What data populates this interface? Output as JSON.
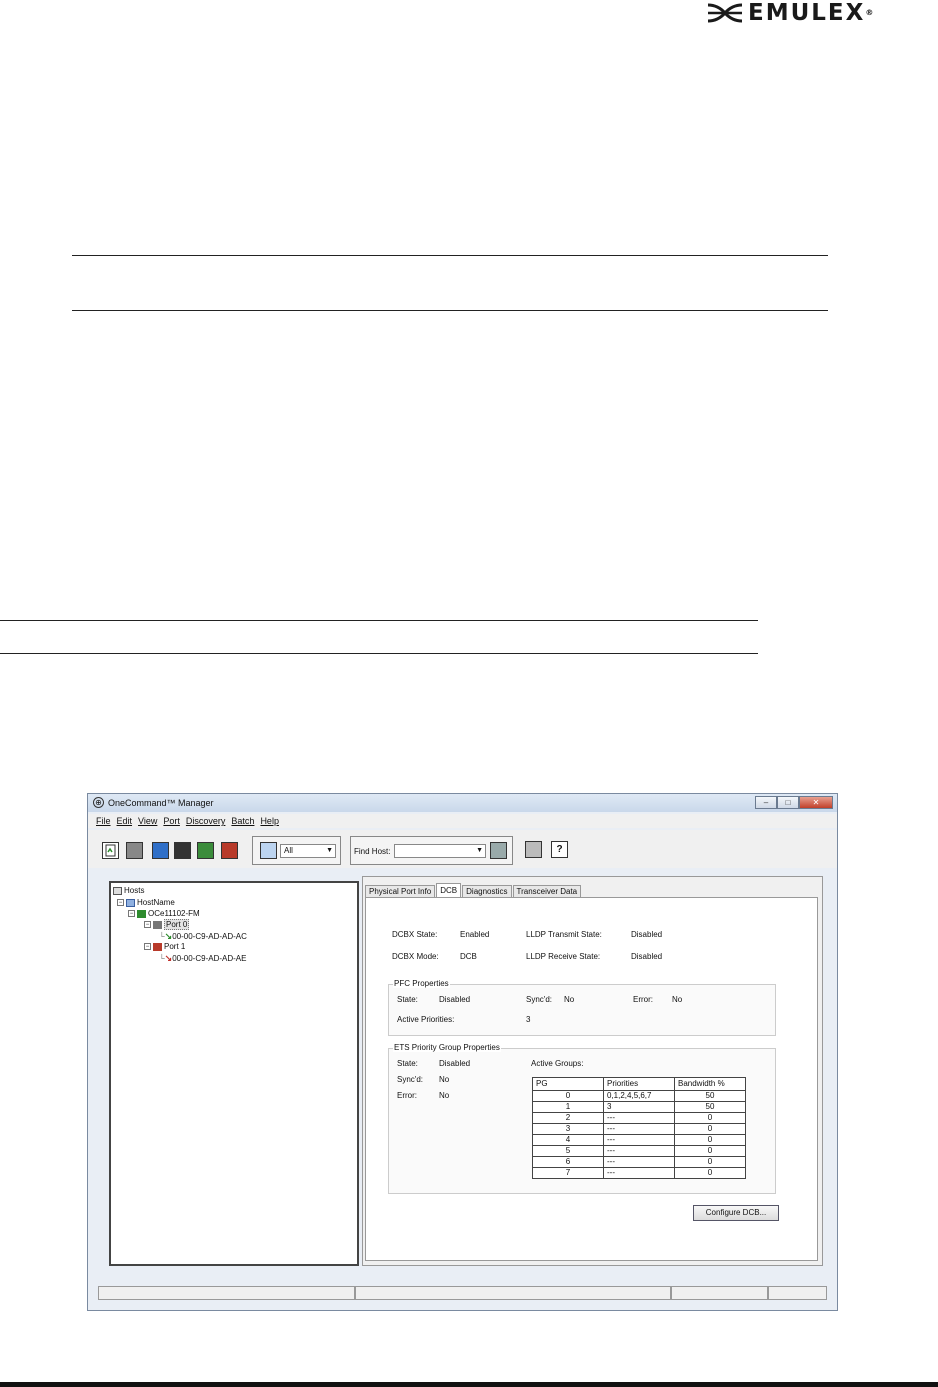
{
  "brand": {
    "name": "EMULEX",
    "registered": "®"
  },
  "app": {
    "title": "OneCommand™ Manager",
    "window_buttons": {
      "minimize": "–",
      "maximize": "□",
      "close": "✕"
    },
    "menu": [
      "File",
      "Edit",
      "View",
      "Port",
      "Discovery",
      "Batch",
      "Help"
    ],
    "toolbar": {
      "filter_value": "All",
      "find_host_label": "Find Host:",
      "find_host_value": "",
      "help_glyph": "?"
    },
    "tree": {
      "root": "Hosts",
      "host": "HostName",
      "adapter": "OCe11102-FM",
      "ports": [
        {
          "label": "Port 0",
          "wwn": "00-00-C9-AD-AD-AC"
        },
        {
          "label": "Port 1",
          "wwn": "00-00-C9-AD-AD-AE"
        }
      ]
    },
    "tabs": [
      "Physical Port Info",
      "DCB",
      "Diagnostics",
      "Transceiver Data"
    ],
    "active_tab": "DCB",
    "dcb": {
      "dcbx_state_label": "DCBX State:",
      "dcbx_state_value": "Enabled",
      "lldp_tx_label": "LLDP Transmit State:",
      "lldp_tx_value": "Disabled",
      "dcbx_mode_label": "DCBX Mode:",
      "dcbx_mode_value": "DCB",
      "lldp_rx_label": "LLDP Receive State:",
      "lldp_rx_value": "Disabled"
    },
    "pfc": {
      "title": "PFC Properties",
      "state_label": "State:",
      "state_value": "Disabled",
      "syncd_label": "Sync'd:",
      "syncd_value": "No",
      "error_label": "Error:",
      "error_value": "No",
      "active_priorities_label": "Active Priorities:",
      "active_priorities_value": "3"
    },
    "ets": {
      "title": "ETS Priority Group Properties",
      "state_label": "State:",
      "state_value": "Disabled",
      "syncd_label": "Sync'd:",
      "syncd_value": "No",
      "error_label": "Error:",
      "error_value": "No",
      "active_groups_label": "Active Groups:",
      "columns": [
        "PG",
        "Priorities",
        "Bandwidth %"
      ],
      "rows": [
        [
          "0",
          "0,1,2,4,5,6,7",
          "50"
        ],
        [
          "1",
          "3",
          "50"
        ],
        [
          "2",
          "---",
          "0"
        ],
        [
          "3",
          "---",
          "0"
        ],
        [
          "4",
          "---",
          "0"
        ],
        [
          "5",
          "---",
          "0"
        ],
        [
          "6",
          "---",
          "0"
        ],
        [
          "7",
          "---",
          "0"
        ]
      ]
    },
    "configure_button": "Configure DCB..."
  }
}
